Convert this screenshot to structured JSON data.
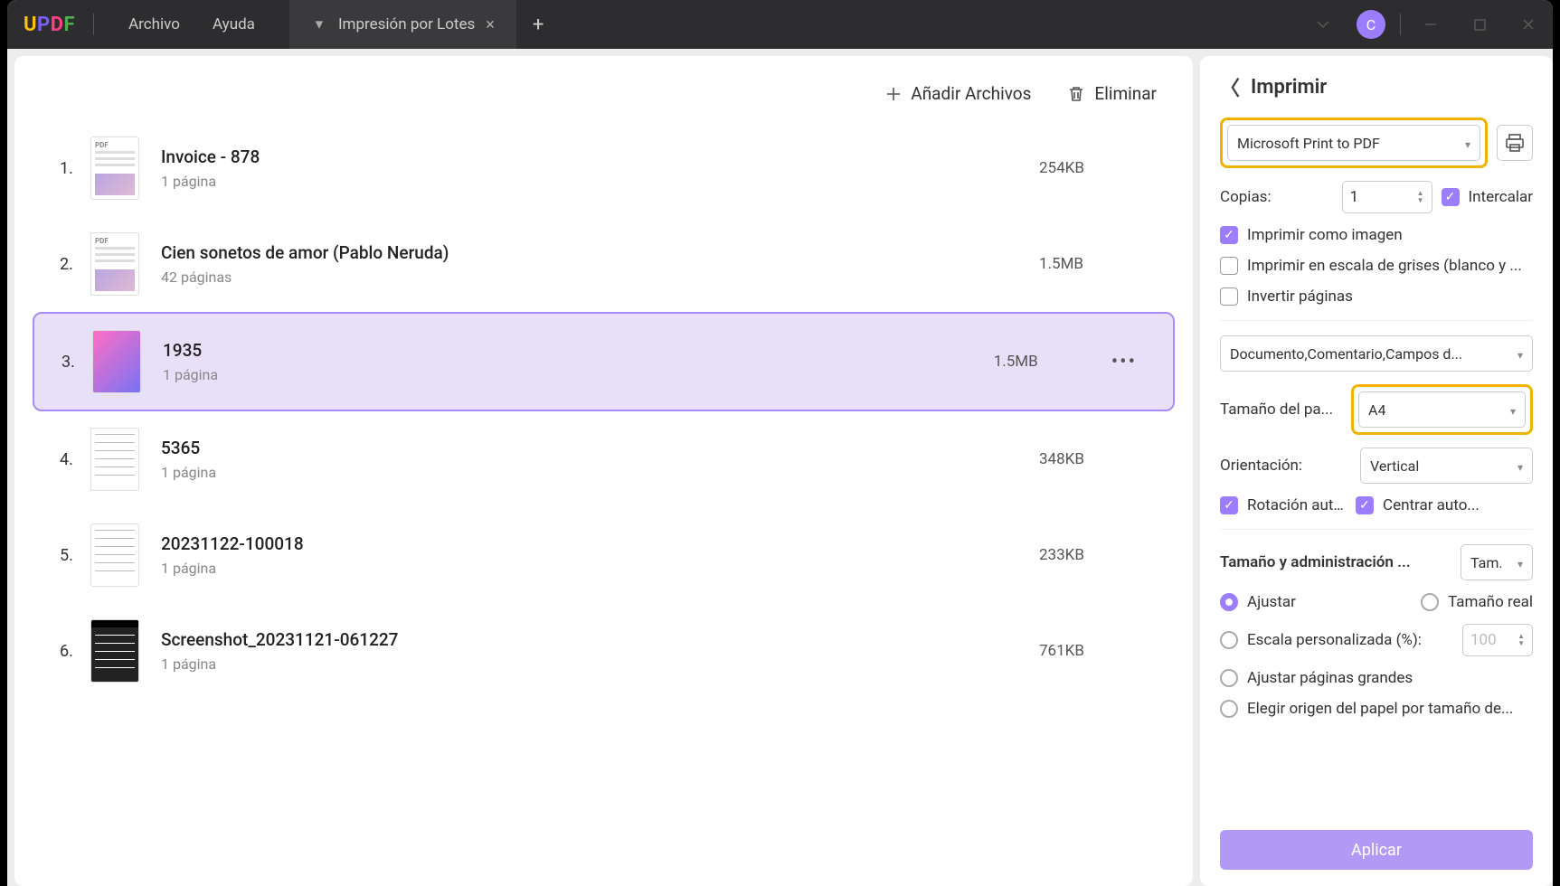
{
  "logo": {
    "u": "U",
    "p": "P",
    "d": "D",
    "f": "F"
  },
  "menu": {
    "archivo": "Archivo",
    "ayuda": "Ayuda"
  },
  "tab": {
    "title": "Impresión por Lotes"
  },
  "avatar": "C",
  "toolbar": {
    "add": "Añadir Archivos",
    "del": "Eliminar"
  },
  "files": [
    {
      "num": "1.",
      "name": "Invoice - 878",
      "meta": "1 página",
      "size": "254KB",
      "thumb": "pdf",
      "selected": false
    },
    {
      "num": "2.",
      "name": "Cien sonetos de amor (Pablo Neruda)",
      "meta": "42 páginas",
      "size": "1.5MB",
      "thumb": "pdf",
      "selected": false
    },
    {
      "num": "3.",
      "name": "1935",
      "meta": "1 página",
      "size": "1.5MB",
      "thumb": "img",
      "selected": true
    },
    {
      "num": "4.",
      "name": "5365",
      "meta": "1 página",
      "size": "348KB",
      "thumb": "doc",
      "selected": false
    },
    {
      "num": "5.",
      "name": "20231122-100018",
      "meta": "1 página",
      "size": "233KB",
      "thumb": "doc",
      "selected": false
    },
    {
      "num": "6.",
      "name": "Screenshot_20231121-061227",
      "meta": "1 página",
      "size": "761KB",
      "thumb": "dark",
      "selected": false
    }
  ],
  "panel": {
    "title": "Imprimir",
    "printer": "Microsoft Print to PDF",
    "copies_label": "Copias:",
    "copies_value": "1",
    "collate": "Intercalar",
    "print_as_image": "Imprimir como imagen",
    "grayscale": "Imprimir en escala de grises (blanco y ...",
    "reverse": "Invertir páginas",
    "content_select": "Documento,Comentario,Campos d...",
    "paper_size_label": "Tamaño del pa...",
    "paper_size": "A4",
    "orientation_label": "Orientación:",
    "orientation": "Vertical",
    "auto_rotate": "Rotación auto...",
    "auto_center": "Centrar auto...",
    "size_mgmt_label": "Tamaño y administración ...",
    "size_mgmt_sel": "Tam.",
    "fit": "Ajustar",
    "actual": "Tamaño real",
    "custom_scale": "Escala personalizada (%):",
    "custom_scale_val": "100",
    "fit_large": "Ajustar páginas grandes",
    "paper_source": "Elegir origen del papel por tamaño de...",
    "apply": "Aplicar"
  }
}
